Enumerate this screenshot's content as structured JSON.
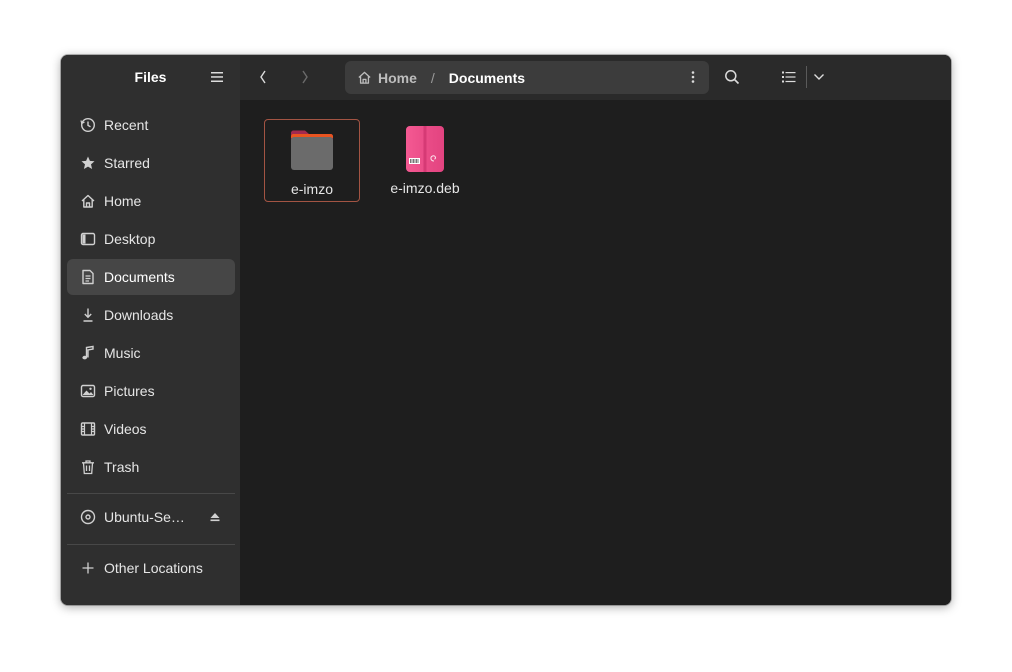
{
  "sidebar": {
    "title": "Files",
    "items": [
      {
        "label": "Recent"
      },
      {
        "label": "Starred"
      },
      {
        "label": "Home"
      },
      {
        "label": "Desktop"
      },
      {
        "label": "Documents",
        "active": true
      },
      {
        "label": "Downloads"
      },
      {
        "label": "Music"
      },
      {
        "label": "Pictures"
      },
      {
        "label": "Videos"
      },
      {
        "label": "Trash"
      }
    ],
    "device": {
      "label": "Ubuntu-Se…"
    },
    "other_locations": {
      "label": "Other Locations"
    }
  },
  "header": {
    "path": {
      "home": "Home",
      "separator": "/",
      "current": "Documents"
    }
  },
  "files": [
    {
      "name": "e-imzo",
      "type": "folder",
      "selected": true
    },
    {
      "name": "e-imzo.deb",
      "type": "debian-package"
    }
  ],
  "colors": {
    "accent": "#e95420",
    "selection_border": "#a35443",
    "package_pink": "#ee4f8a"
  }
}
